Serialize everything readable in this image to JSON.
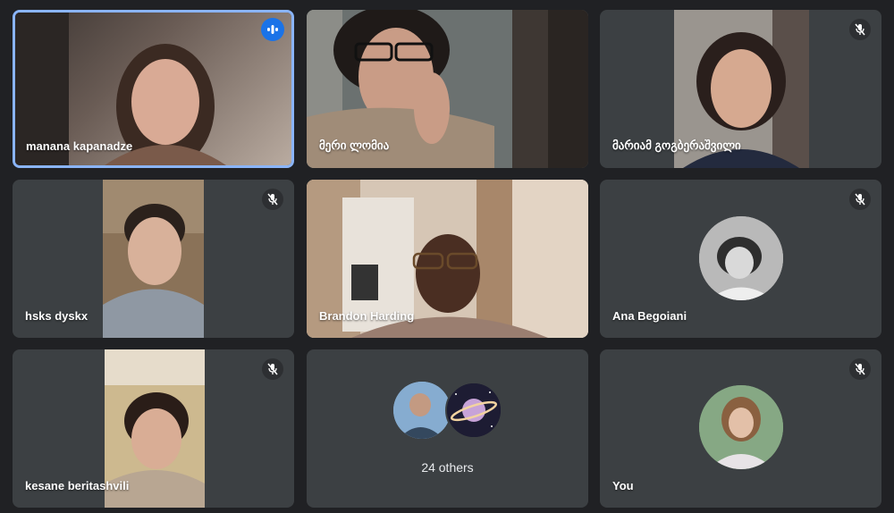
{
  "participants": [
    {
      "name": "manana kapanadze",
      "status": "speaking"
    },
    {
      "name": "მერი ლომია",
      "status": "video"
    },
    {
      "name": "მარიამ გოგბერაშვილი",
      "status": "muted"
    },
    {
      "name": "hsks dyskx",
      "status": "muted"
    },
    {
      "name": "Brandon Harding",
      "status": "video"
    },
    {
      "name": "Ana Begoiani",
      "status": "muted"
    },
    {
      "name": "kesane beritashvili",
      "status": "muted"
    },
    {
      "name": "24 others",
      "status": "group"
    },
    {
      "name": "You",
      "status": "muted"
    }
  ],
  "colors": {
    "background": "#202124",
    "tile": "#3c4043",
    "active_border": "#8ab4f8",
    "speaking": "#1a73e8"
  },
  "icons": [
    "mic-off-icon",
    "speaking-indicator-icon"
  ]
}
